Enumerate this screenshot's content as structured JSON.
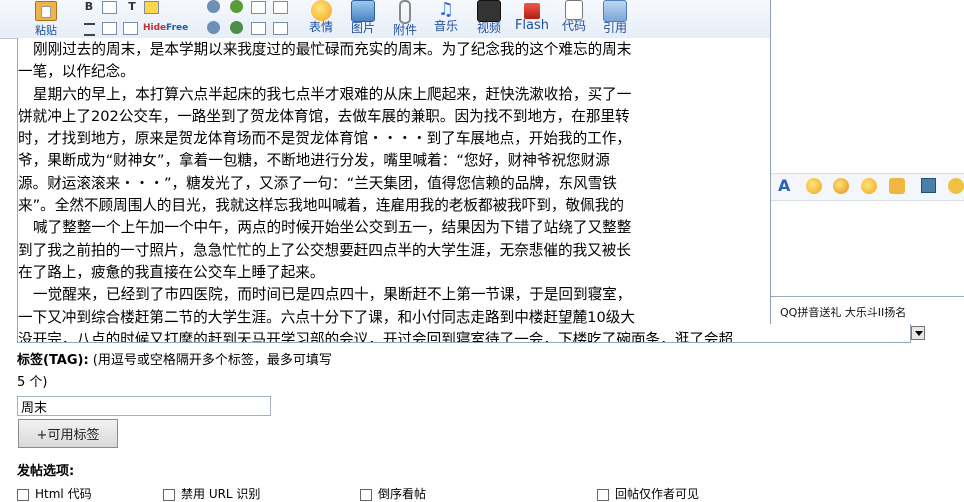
{
  "toolbar": {
    "paste": "粘贴",
    "emoticon": "表情",
    "image": "图片",
    "attachment": "附件",
    "music": "音乐",
    "video": "视频",
    "flash": "Flash",
    "code": "代码",
    "quote": "引用",
    "bold": "B",
    "hide": "Hide",
    "free": "Free"
  },
  "editor": {
    "paragraphs": [
      "刚刚过去的周末，是本学期以来我度过的最忙碌而充实的周末。为了纪念我的这个难忘的周末",
      "一笔，以作纪念。",
      "星期六的早上，本打算六点半起床的我七点半才艰难的从床上爬起来，赶快洗漱收拾，买了一",
      "饼就冲上了202公交车，一路坐到了贺龙体育馆，去做车展的兼职。因为找不到地方，在那里转",
      "时，才找到地方，原来是贺龙体育场而不是贺龙体育馆・・・・到了车展地点，开始我的工作，",
      "爷，果断成为“财神女”，拿着一包糖，不断地进行分发，嘴里喊着：“您好，财神爷祝您财源",
      "源。财运滚滚来・・・”，糖发光了，又添了一句：“兰天集团，值得您信赖的品牌，东风雪铁",
      "来”。全然不顾周围人的目光，我就这样忘我地叫喊着，连雇用我的老板都被我吓到，敬佩我的",
      "喊了整整一个上午加一个中午，两点的时候开始坐公交到五一，结果因为下错了站绕了又整整",
      "到了我之前拍的一寸照片，急急忙忙的上了公交想要赶四点半的大学生涯，无奈悲催的我又被长",
      "在了路上，疲惫的我直接在公交车上睡了起来。",
      "一觉醒来，已经到了市四医院，而时间已是四点四十，果断赶不上第一节课，于是回到寝室，",
      "一下又冲到综合楼赶第二节的大学生涯。六点十分下了课，和小付同志走路到中楼赶望麓10级大",
      "没开完，八点的时候又打摩的赶到天马开学习部的会议，开过会回到寝室待了一会，下楼吃了碗面条，逛了会超"
    ],
    "indented": [
      true,
      false,
      true,
      false,
      false,
      false,
      false,
      false,
      true,
      false,
      false,
      true,
      false,
      false
    ]
  },
  "panel": {
    "footer_text": "QQ拼音送礼 大乐斗II扬名"
  },
  "tag": {
    "label_bold": "标签(TAG):",
    "hint": " (用逗号或空格隔开多个标签，最多可填写",
    "hint2": "5 个)",
    "value": "周末",
    "button": "+可用标签"
  },
  "options": {
    "title": "发帖选项:",
    "items": [
      "Html 代码",
      "禁用 URL 识别",
      "倒序看帖",
      "回帖仅作者可见"
    ]
  },
  "colors": {
    "toolbar_label": "#2050a0",
    "panel_border": "#8f9fb4"
  }
}
